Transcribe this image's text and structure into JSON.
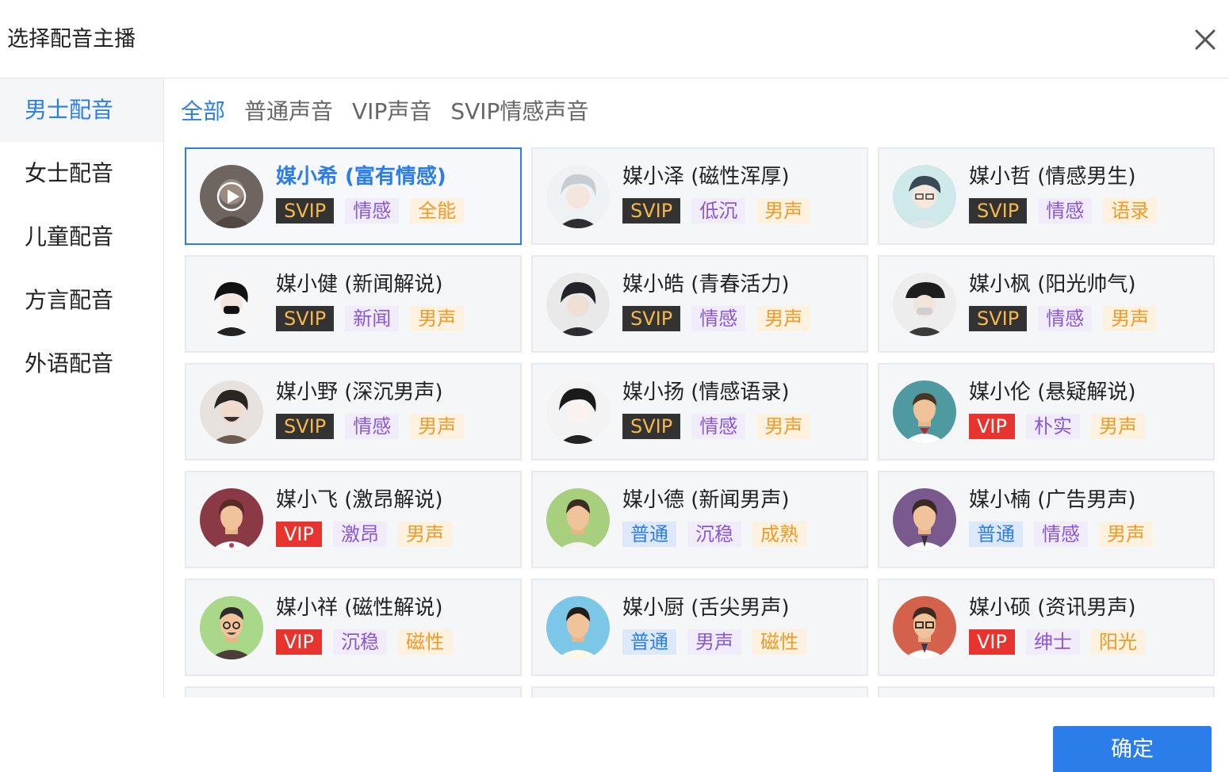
{
  "dialog": {
    "title": "选择配音主播",
    "close_icon": "close-icon"
  },
  "sidebar": {
    "items": [
      {
        "label": "男士配音",
        "active": true
      },
      {
        "label": "女士配音",
        "active": false
      },
      {
        "label": "儿童配音",
        "active": false
      },
      {
        "label": "方言配音",
        "active": false
      },
      {
        "label": "外语配音",
        "active": false
      }
    ]
  },
  "tabs": [
    {
      "label": "全部",
      "active": true
    },
    {
      "label": "普通声音",
      "active": false
    },
    {
      "label": "VIP声音",
      "active": false
    },
    {
      "label": "SVIP情感声音",
      "active": false
    }
  ],
  "voices": [
    {
      "name": "媒小希 (富有情感)",
      "selected": true,
      "avatar": "anime-portrait-play",
      "tags": [
        {
          "text": "SVIP",
          "type": "svip"
        },
        {
          "text": "情感",
          "type": "purple"
        },
        {
          "text": "全能",
          "type": "orange"
        }
      ]
    },
    {
      "name": "媒小泽 (磁性浑厚)",
      "selected": false,
      "avatar": "anime-silver-hair",
      "tags": [
        {
          "text": "SVIP",
          "type": "svip"
        },
        {
          "text": "低沉",
          "type": "purple"
        },
        {
          "text": "男声",
          "type": "orange"
        }
      ]
    },
    {
      "name": "媒小哲 (情感男生)",
      "selected": false,
      "avatar": "anime-glasses",
      "tags": [
        {
          "text": "SVIP",
          "type": "svip"
        },
        {
          "text": "情感",
          "type": "purple"
        },
        {
          "text": "语录",
          "type": "orange"
        }
      ]
    },
    {
      "name": "媒小健 (新闻解说)",
      "selected": false,
      "avatar": "anime-mask",
      "tags": [
        {
          "text": "SVIP",
          "type": "svip"
        },
        {
          "text": "新闻",
          "type": "purple"
        },
        {
          "text": "男声",
          "type": "orange"
        }
      ]
    },
    {
      "name": "媒小皓 (青春活力)",
      "selected": false,
      "avatar": "anime-dark-hair",
      "tags": [
        {
          "text": "SVIP",
          "type": "svip"
        },
        {
          "text": "情感",
          "type": "purple"
        },
        {
          "text": "男声",
          "type": "orange"
        }
      ]
    },
    {
      "name": "媒小枫 (阳光帅气)",
      "selected": false,
      "avatar": "anime-cap-mask",
      "tags": [
        {
          "text": "SVIP",
          "type": "svip"
        },
        {
          "text": "情感",
          "type": "purple"
        },
        {
          "text": "男声",
          "type": "orange"
        }
      ]
    },
    {
      "name": "媒小野 (深沉男声)",
      "selected": false,
      "avatar": "anime-beard",
      "tags": [
        {
          "text": "SVIP",
          "type": "svip"
        },
        {
          "text": "情感",
          "type": "purple"
        },
        {
          "text": "男声",
          "type": "orange"
        }
      ]
    },
    {
      "name": "媒小扬 (情感语录)",
      "selected": false,
      "avatar": "anime-sketch",
      "tags": [
        {
          "text": "SVIP",
          "type": "svip"
        },
        {
          "text": "情感",
          "type": "purple"
        },
        {
          "text": "男声",
          "type": "orange"
        }
      ]
    },
    {
      "name": "媒小伦 (悬疑解说)",
      "selected": false,
      "avatar": "flat-teal",
      "tags": [
        {
          "text": "VIP",
          "type": "vip"
        },
        {
          "text": "朴实",
          "type": "purple"
        },
        {
          "text": "男声",
          "type": "orange"
        }
      ]
    },
    {
      "name": "媒小飞 (激昂解说)",
      "selected": false,
      "avatar": "flat-maroon",
      "tags": [
        {
          "text": "VIP",
          "type": "vip"
        },
        {
          "text": "激昂",
          "type": "purple"
        },
        {
          "text": "男声",
          "type": "orange"
        }
      ]
    },
    {
      "name": "媒小德 (新闻男声)",
      "selected": false,
      "avatar": "flat-green",
      "tags": [
        {
          "text": "普通",
          "type": "normal"
        },
        {
          "text": "沉稳",
          "type": "purple"
        },
        {
          "text": "成熟",
          "type": "orange"
        }
      ]
    },
    {
      "name": "媒小楠 (广告男声)",
      "selected": false,
      "avatar": "flat-purple",
      "tags": [
        {
          "text": "普通",
          "type": "normal"
        },
        {
          "text": "情感",
          "type": "purple"
        },
        {
          "text": "男声",
          "type": "orange"
        }
      ]
    },
    {
      "name": "媒小祥 (磁性解说)",
      "selected": false,
      "avatar": "flat-lightgreen-glasses",
      "tags": [
        {
          "text": "VIP",
          "type": "vip"
        },
        {
          "text": "沉稳",
          "type": "purple"
        },
        {
          "text": "磁性",
          "type": "orange"
        }
      ]
    },
    {
      "name": "媒小厨 (舌尖男声)",
      "selected": false,
      "avatar": "flat-skyblue",
      "tags": [
        {
          "text": "普通",
          "type": "normal"
        },
        {
          "text": "男声",
          "type": "purple"
        },
        {
          "text": "磁性",
          "type": "orange"
        }
      ]
    },
    {
      "name": "媒小硕 (资讯男声)",
      "selected": false,
      "avatar": "flat-red-glasses",
      "tags": [
        {
          "text": "VIP",
          "type": "vip"
        },
        {
          "text": "绅士",
          "type": "purple"
        },
        {
          "text": "阳光",
          "type": "orange"
        }
      ]
    }
  ],
  "footer": {
    "confirm_label": "确定"
  },
  "colors": {
    "accent": "#2b7de9",
    "svip_bg": "#333333",
    "svip_text": "#f6b84a",
    "vip_bg": "#e8342e",
    "purple_text": "#8a57d6",
    "orange_text": "#f19a28"
  }
}
